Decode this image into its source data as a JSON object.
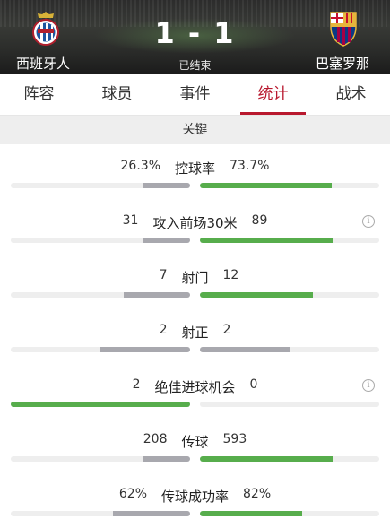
{
  "match": {
    "home_team": "西班牙人",
    "away_team": "巴塞罗那",
    "score": "1 - 1",
    "status": "已结束",
    "home_crest_icon": "espanyol-crest-icon",
    "away_crest_icon": "barcelona-crest-icon"
  },
  "tabs": [
    {
      "label": "阵容",
      "active": false
    },
    {
      "label": "球员",
      "active": false
    },
    {
      "label": "事件",
      "active": false
    },
    {
      "label": "统计",
      "active": true
    },
    {
      "label": "战术",
      "active": false
    }
  ],
  "section_title": "关键",
  "colors": {
    "accent": "#b8182e",
    "home_bar": "#a8a8ae",
    "away_bar": "#57ad4c",
    "winner_bar": "#57ad4c",
    "bar_track": "#eeeeee"
  },
  "stats": [
    {
      "label": "控球率",
      "home": "26.3%",
      "away": "73.7%",
      "home_ratio": 0.263,
      "away_ratio": 0.737,
      "leader": "away",
      "info": false
    },
    {
      "label": "攻入前场30米",
      "home": "31",
      "away": "89",
      "home_ratio": 0.26,
      "away_ratio": 0.74,
      "leader": "away",
      "info": true
    },
    {
      "label": "射门",
      "home": "7",
      "away": "12",
      "home_ratio": 0.37,
      "away_ratio": 0.63,
      "leader": "away",
      "info": false
    },
    {
      "label": "射正",
      "home": "2",
      "away": "2",
      "home_ratio": 0.5,
      "away_ratio": 0.5,
      "leader": "none",
      "info": false
    },
    {
      "label": "绝佳进球机会",
      "home": "2",
      "away": "0",
      "home_ratio": 1.0,
      "away_ratio": 0.0,
      "leader": "home",
      "info": true
    },
    {
      "label": "传球",
      "home": "208",
      "away": "593",
      "home_ratio": 0.26,
      "away_ratio": 0.74,
      "leader": "away",
      "info": false
    },
    {
      "label": "传球成功率",
      "home": "62%",
      "away": "82%",
      "home_ratio": 0.43,
      "away_ratio": 0.57,
      "leader": "away",
      "info": false
    }
  ]
}
